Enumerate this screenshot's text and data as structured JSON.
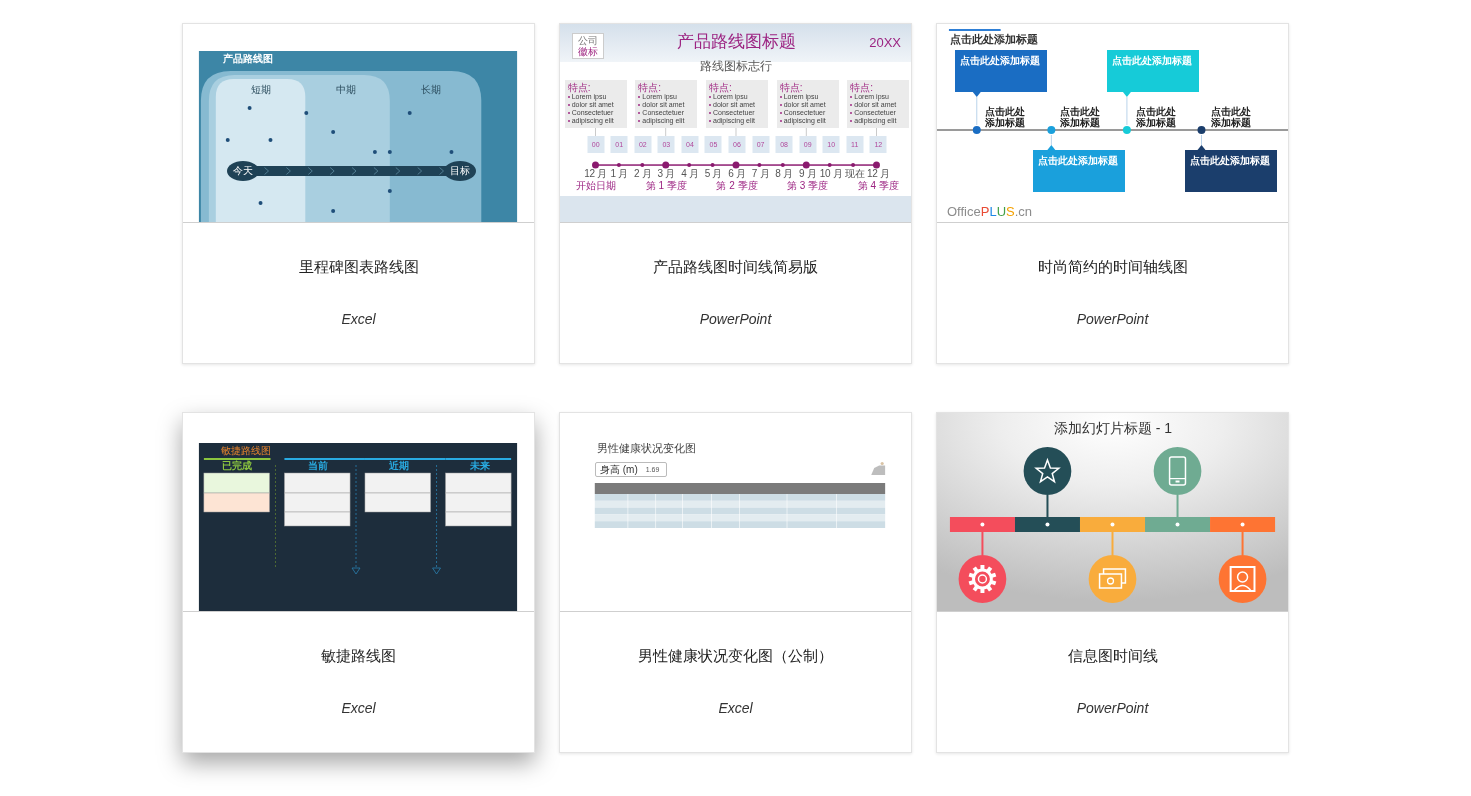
{
  "cards": [
    {
      "title": "里程碑图表路线图",
      "app": "Excel",
      "hovered": false,
      "preview": {
        "kind": "phases",
        "title": "产品路线图",
        "phases": [
          "短期",
          "中期",
          "长期"
        ],
        "start": "今天",
        "end": "目标"
      }
    },
    {
      "title": "产品路线图时间线简易版",
      "app": "PowerPoint",
      "hovered": false,
      "preview": {
        "kind": "monthly",
        "logo": {
          "caption": "公司",
          "text": "徽标"
        },
        "title": "产品路线图标题",
        "year": "20XX",
        "subtitle": "路线图标志行",
        "features": [
          {
            "heading": "特点:",
            "bullets": [
              "Lorem ipsu",
              "dolor sit amet",
              "Consectetuer",
              "adipiscing elit"
            ]
          },
          {
            "heading": "特点:",
            "bullets": [
              "Lorem ipsu",
              "dolor sit amet",
              "Consectetuer",
              "adipiscing elit"
            ]
          },
          {
            "heading": "特点:",
            "bullets": [
              "Lorem ipsu",
              "dolor sit amet",
              "Consectetuer",
              "adipiscing elit"
            ]
          },
          {
            "heading": "特点:",
            "bullets": [
              "Lorem ipsu",
              "dolor sit amet",
              "Consectetuer",
              "adipiscing elit"
            ]
          },
          {
            "heading": "特点:",
            "bullets": [
              "Lorem ipsu",
              "dolor sit amet",
              "Consectetuer",
              "adipiscing elit"
            ]
          }
        ],
        "steps": [
          "00",
          "01",
          "02",
          "03",
          "04",
          "05",
          "06",
          "07",
          "08",
          "09",
          "10",
          "11",
          "12"
        ],
        "months": [
          "12 月",
          "1 月",
          "2 月",
          "3 月",
          "4 月",
          "5 月",
          "6 月",
          "7 月",
          "8 月",
          "9 月",
          "10 月",
          "现在",
          "12 月"
        ],
        "milestones": [
          "开始日期",
          "第 1 季度",
          "第 2 季度",
          "第 3 季度",
          "第 4 季度"
        ]
      }
    },
    {
      "title": "时尚简约的时间轴线图",
      "app": "PowerPoint",
      "hovered": false,
      "preview": {
        "kind": "callouts",
        "title": "点击此处添加标题",
        "events": [
          {
            "label": "点击此处添加标题",
            "callout": "点击此处添加标题",
            "color": "#1a6dc3"
          },
          {
            "label": "点击此处添加标题",
            "callout": "点击此处添加标题",
            "color": "#1aa0dc"
          },
          {
            "label": "点击此处添加标题",
            "callout": "点击此处添加标题",
            "color": "#16cbd8"
          },
          {
            "label": "点击此处添加标题",
            "callout": "点击此处添加标题",
            "color": "#1b3e6c"
          }
        ],
        "brand": {
          "name": "Office",
          "accent": "PLUS",
          "suffix": ".cn"
        }
      }
    },
    {
      "title": "敏捷路线图",
      "app": "Excel",
      "hovered": true,
      "preview": {
        "kind": "kanban",
        "title": "敏捷路线图",
        "columns": [
          {
            "heading": "已完成",
            "color": "#8cc63f",
            "tasks": [
              {
                "color": "#e9f7dd"
              },
              {
                "color": "#fde4d4"
              }
            ]
          },
          {
            "heading": "当前",
            "color": "#29abe2",
            "tasks": [
              {
                "color": "#f2f2f2"
              },
              {
                "color": "#f2f2f2"
              },
              {
                "color": "#f2f2f2"
              }
            ]
          },
          {
            "heading": "近期",
            "color": "#29abe2",
            "tasks": [
              {
                "color": "#f2f2f2"
              },
              {
                "color": "#f2f2f2"
              }
            ]
          },
          {
            "heading": "未来",
            "color": "#29abe2",
            "tasks": [
              {
                "color": "#f2f2f2"
              },
              {
                "color": "#f2f2f2"
              },
              {
                "color": "#f2f2f2"
              }
            ]
          }
        ]
      }
    },
    {
      "title": "男性健康状况变化图（公制）",
      "app": "Excel",
      "hovered": false,
      "preview": {
        "kind": "table",
        "title": "男性健康状况变化图",
        "field": {
          "label": "身高 (m)",
          "value": "1.69"
        }
      }
    },
    {
      "title": "信息图时间线",
      "app": "PowerPoint",
      "hovered": false,
      "preview": {
        "kind": "infographic",
        "title": "添加幻灯片标题 - 1",
        "segments": [
          {
            "color": "#f44d5c"
          },
          {
            "color": "#244e57"
          },
          {
            "color": "#f9ac3c"
          },
          {
            "color": "#6fab92"
          },
          {
            "color": "#fe7433"
          }
        ]
      }
    }
  ]
}
